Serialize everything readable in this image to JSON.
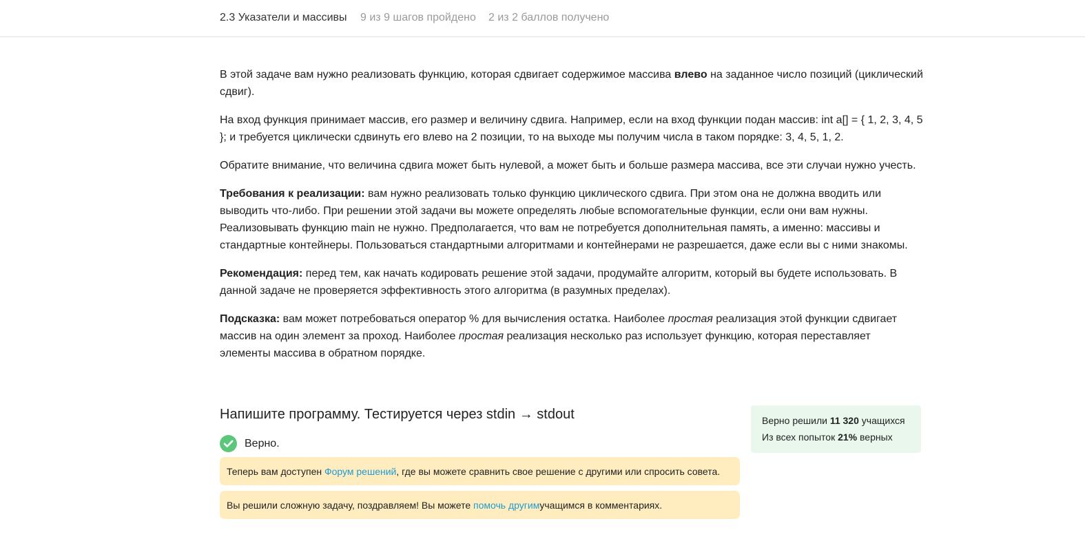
{
  "header": {
    "lesson_title": "2.3 Указатели и массивы",
    "steps_progress": "9 из 9 шагов пройдено",
    "points_progress": "2 из 2 баллов  получено"
  },
  "task": {
    "p1": {
      "a": "В этой задаче вам нужно реализовать функцию, которая сдвигает содержимое массива ",
      "b": "влево",
      "c": " на заданное число позиций (циклический сдвиг)."
    },
    "p2": "На вход функция принимает массив, его размер и величину сдвига. Например, если на вход функции подан массив: int a[] = { 1, 2, 3, 4, 5 }; и требуется циклически сдвинуть его влево на 2 позиции, то на выходе мы получим числа в таком порядке: 3, 4, 5, 1, 2.",
    "p3": "Обратите внимание, что величина сдвига может быть нулевой, а может быть и больше размера массива, все эти случаи нужно учесть.",
    "p4": {
      "label": "Требования к реализации:",
      "text": " вам нужно реализовать только функцию циклического сдвига. При этом она не должна вводить или выводить что-либо. При решении этой задачи вы можете определять любые вспомогательные функции, если они вам нужны. Реализовывать функцию main не нужно. Предполагается, что вам не потребуется дополнительная память, а именно: массивы и стандартные контейнеры. Пользоваться стандартными алгоритмами и контейнерами не разрешается, даже если вы с ними знакомы."
    },
    "p5": {
      "label": "Рекомендация:",
      "text": " перед тем, как начать кодировать решение этой задачи, продумайте алгоритм, который вы будете использовать. В данной задаче не проверяется эффективность этого алгоритма (в разумных пределах)."
    },
    "p6": {
      "label": "Подсказка:",
      "t1": " вам может потребоваться оператор % для вычисления остатка. Наиболее ",
      "em1": "простая",
      "t2": " реализация этой функции сдвигает массив на один элемент за проход. Наиболее ",
      "em2": "простая",
      "t3": " реализация несколько раз использует функцию, которая переставляет элементы массива в обратном порядке."
    }
  },
  "quiz": {
    "title": "Напишите программу. Тестируется через stdin → stdout",
    "status": "Верно.",
    "status_icon": "check-circle-icon",
    "status_color": "#5cc77a"
  },
  "notices": {
    "forum": {
      "before": "Теперь вам доступен ",
      "link": "Форум решений",
      "after": " , где вы можете сравнить свое решение с другими или спросить совета."
    },
    "congrats": {
      "before": "Вы решили сложную задачу, поздравляем! Вы можете ",
      "link": "помочь другим",
      "after": " учащимся в комментариях."
    },
    "background_color": "#ffedc0",
    "link_color": "#1f9bd1"
  },
  "stats": {
    "solved_prefix": "Верно решили ",
    "solved_count": "11 320",
    "solved_suffix": " учащихся",
    "attempts_prefix": "Из всех попыток ",
    "attempts_percent": "21%",
    "attempts_suffix": " верных",
    "background_color": "#e9f7ec"
  }
}
